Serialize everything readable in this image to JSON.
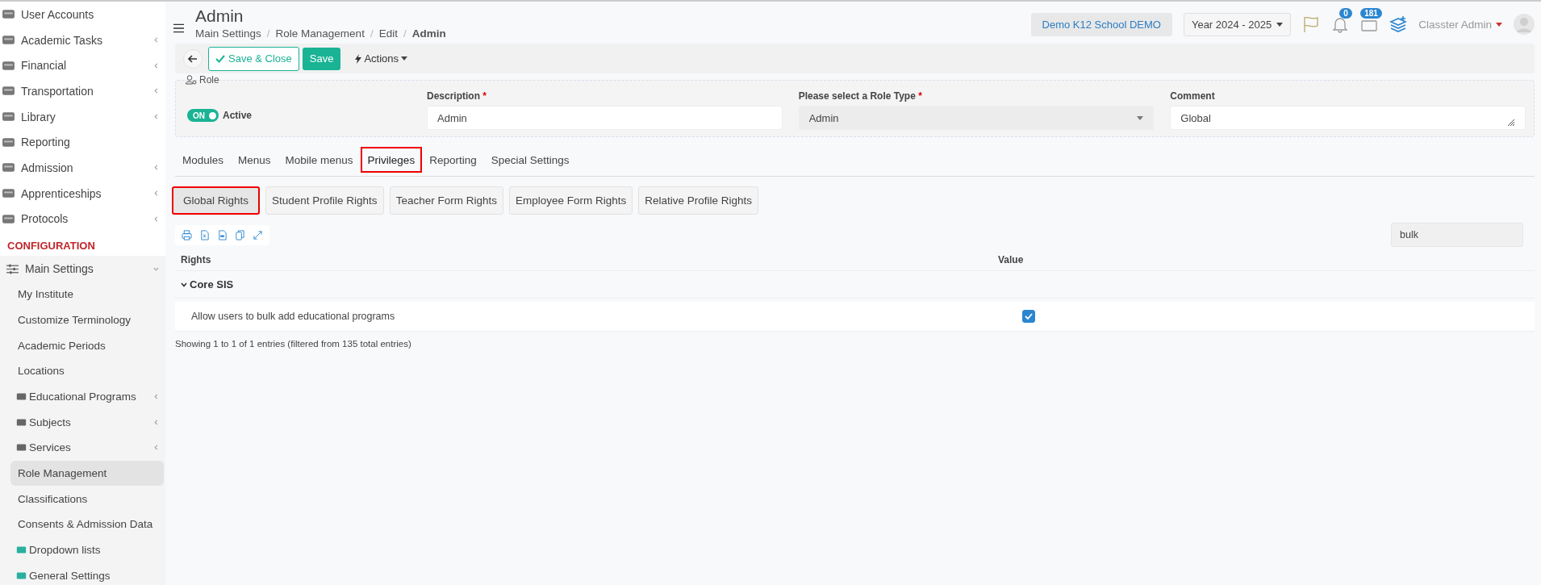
{
  "sidebar": {
    "items": [
      {
        "label": "User Accounts",
        "submenu": false
      },
      {
        "label": "Academic Tasks",
        "submenu": true
      },
      {
        "label": "Financial",
        "submenu": true
      },
      {
        "label": "Transportation",
        "submenu": true
      },
      {
        "label": "Library",
        "submenu": true
      },
      {
        "label": "Reporting",
        "submenu": false
      },
      {
        "label": "Admission",
        "submenu": true
      },
      {
        "label": "Apprenticeships",
        "submenu": true
      },
      {
        "label": "Protocols",
        "submenu": true
      }
    ],
    "section_title": "CONFIGURATION",
    "group": {
      "label": "Main Settings",
      "expanded": true,
      "children": [
        {
          "label": "My Institute",
          "kind": "plain",
          "submenu": false,
          "selected": false
        },
        {
          "label": "Customize Terminology",
          "kind": "plain",
          "submenu": false,
          "selected": false
        },
        {
          "label": "Academic Periods",
          "kind": "plain",
          "submenu": false,
          "selected": false
        },
        {
          "label": "Locations",
          "kind": "plain",
          "submenu": false,
          "selected": false
        },
        {
          "label": "Educational Programs",
          "kind": "icon",
          "submenu": true,
          "selected": false
        },
        {
          "label": "Subjects",
          "kind": "icon",
          "submenu": true,
          "selected": false
        },
        {
          "label": "Services",
          "kind": "icon",
          "submenu": true,
          "selected": false
        },
        {
          "label": "Role Management",
          "kind": "plain",
          "submenu": false,
          "selected": true
        },
        {
          "label": "Classifications",
          "kind": "plain",
          "submenu": false,
          "selected": false
        },
        {
          "label": "Consents & Admission Data",
          "kind": "plain",
          "submenu": false,
          "selected": false
        },
        {
          "label": "Dropdown lists",
          "kind": "icon",
          "submenu": false,
          "selected": false
        },
        {
          "label": "General Settings",
          "kind": "icon",
          "submenu": false,
          "selected": false
        }
      ]
    }
  },
  "header": {
    "title": "Admin",
    "breadcrumb": [
      "Main Settings",
      "Role Management",
      "Edit",
      "Admin"
    ],
    "breadcrumb_separator": "/",
    "school": "Demo K12 School DEMO",
    "year": "Year 2024 - 2025",
    "notifications": "0",
    "messages": "181",
    "user": "Classter Admin"
  },
  "toolbar": {
    "save_close": "Save & Close",
    "save": "Save",
    "actions": "Actions"
  },
  "role": {
    "legend": "Role",
    "active_on": true,
    "toggle_text": "ON",
    "active_label": "Active",
    "required_mark": "*",
    "description_label": "Description",
    "description": "Admin",
    "type_label": "Please select a Role Type",
    "type": "Admin",
    "comment_label": "Comment",
    "comment": "Global"
  },
  "tabs": [
    {
      "label": "Modules",
      "selected": false
    },
    {
      "label": "Menus",
      "selected": false
    },
    {
      "label": "Mobile menus",
      "selected": false
    },
    {
      "label": "Privileges",
      "selected": true
    },
    {
      "label": "Reporting",
      "selected": false
    },
    {
      "label": "Special Settings",
      "selected": false
    }
  ],
  "subtabs": [
    {
      "label": "Global Rights",
      "selected": true
    },
    {
      "label": "Student Profile Rights",
      "selected": false
    },
    {
      "label": "Teacher Form Rights",
      "selected": false
    },
    {
      "label": "Employee Form Rights",
      "selected": false
    },
    {
      "label": "Relative Profile Rights",
      "selected": false
    }
  ],
  "search": {
    "value": "bulk"
  },
  "table": {
    "columns": [
      "Rights",
      "Value"
    ],
    "groups": [
      {
        "label": "Core SIS",
        "expanded": true,
        "rows": [
          {
            "right": "Allow users to bulk add educational programs",
            "checked": true
          }
        ]
      }
    ],
    "footer": "Showing 1 to 1 of 1 entries (filtered from 135 total entries)"
  }
}
